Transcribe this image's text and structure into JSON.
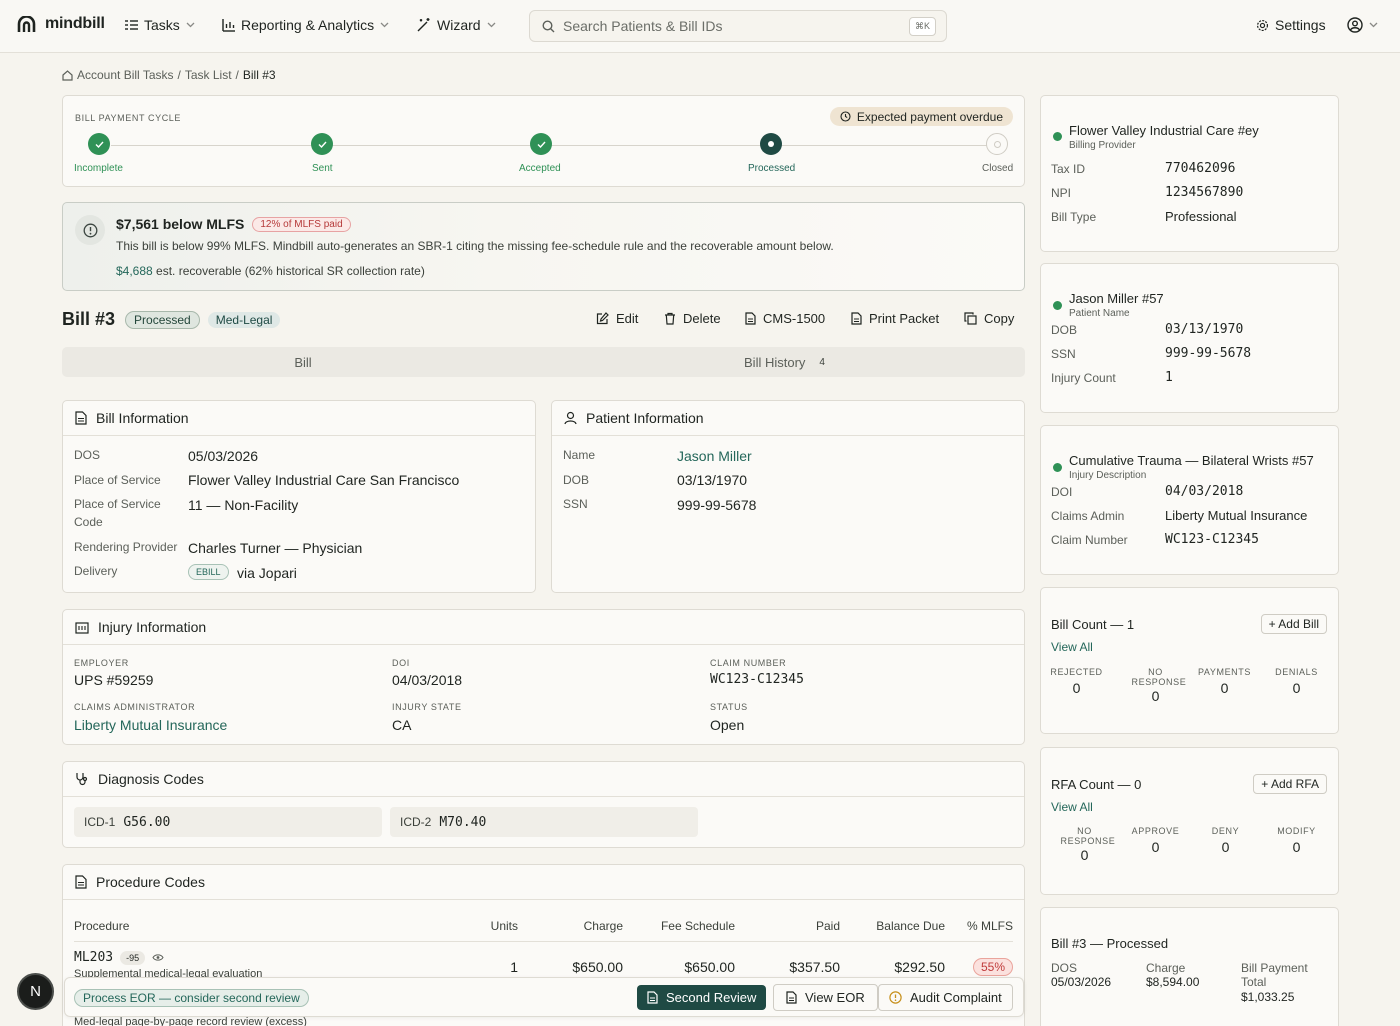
{
  "app": {
    "name": "mindbill"
  },
  "nav": {
    "tasks": "Tasks",
    "reporting": "Reporting & Analytics",
    "wizard": "Wizard",
    "search_placeholder": "Search Patients & Bill IDs",
    "shortcut": "⌘K",
    "settings": "Settings"
  },
  "breadcrumb": {
    "items": [
      "Account Bill Tasks",
      "Task List",
      "Bill #3"
    ],
    "sep": "/"
  },
  "cycle": {
    "label": "BILL PAYMENT CYCLE",
    "overdue": "Expected payment overdue",
    "steps": [
      {
        "label": "Incomplete",
        "state": "done"
      },
      {
        "label": "Sent",
        "state": "done"
      },
      {
        "label": "Accepted",
        "state": "done"
      },
      {
        "label": "Processed",
        "state": "current"
      },
      {
        "label": "Closed",
        "state": "pending"
      }
    ]
  },
  "mlfs": {
    "title": "$7,561 below MLFS",
    "badge": "12% of MLFS paid",
    "desc": "This bill is below 99% MLFS. Mindbill auto-generates an SBR-1 citing the missing fee-schedule rule and the recoverable amount below.",
    "amount": "$4,688",
    "note": "est. recoverable (62% historical SR collection rate)"
  },
  "bill": {
    "title": "Bill #3",
    "status": "Processed",
    "type": "Med-Legal",
    "actions": {
      "edit": "Edit",
      "delete": "Delete",
      "cms": "CMS-1500",
      "print": "Print Packet",
      "copy": "Copy"
    }
  },
  "tabs": {
    "bill": "Bill",
    "history": "Bill History",
    "history_count": "4"
  },
  "bill_info": {
    "title": "Bill Information",
    "dos_l": "DOS",
    "dos": "05/03/2026",
    "pos_l": "Place of Service",
    "pos": "Flower Valley Industrial Care San Francisco",
    "posc_l1": "Place of Service",
    "posc_l2": "Code",
    "posc": "11 — Non-Facility",
    "rp_l": "Rendering Provider",
    "rp": "Charles Turner — Physician",
    "del_l": "Delivery",
    "del_badge": "EBILL",
    "del": "via Jopari"
  },
  "patient_info": {
    "title": "Patient Information",
    "name_l": "Name",
    "name": "Jason Miller",
    "dob_l": "DOB",
    "dob": "03/13/1970",
    "ssn_l": "SSN",
    "ssn": "999-99-5678"
  },
  "injury": {
    "title": "Injury Information",
    "employer_l": "EMPLOYER",
    "employer": "UPS #59259",
    "doi_l": "DOI",
    "doi": "04/03/2018",
    "claim_l": "CLAIM NUMBER",
    "claim": "WC123-C12345",
    "admin_l": "CLAIMS ADMINISTRATOR",
    "admin": "Liberty Mutual Insurance",
    "state_l": "INJURY STATE",
    "state": "CA",
    "status_l": "STATUS",
    "status": "Open"
  },
  "diagnosis": {
    "title": "Diagnosis Codes",
    "codes": [
      {
        "k": "ICD-1",
        "v": "G56.00"
      },
      {
        "k": "ICD-2",
        "v": "M70.40"
      }
    ]
  },
  "procedures": {
    "title": "Procedure Codes",
    "headers": [
      "Procedure",
      "Units",
      "Charge",
      "Fee Schedule",
      "Paid",
      "Balance Due",
      "% MLFS"
    ],
    "rows": [
      {
        "code": "ML203",
        "mod": "-95",
        "desc": "Supplemental medical-legal evaluation",
        "units": "1",
        "charge": "$650.00",
        "fee": "$650.00",
        "paid": "$357.50",
        "balance": "$292.50",
        "pct": "55%"
      },
      {
        "desc": "Med-legal page-by-page record review (excess)"
      }
    ]
  },
  "actionbar": {
    "hint": "Process EOR — consider second review",
    "second": "Second Review",
    "view": "View EOR",
    "audit": "Audit Complaint"
  },
  "side": {
    "provider": {
      "name": "Flower Valley Industrial Care #ey",
      "sub": "Billing Provider",
      "tax_l": "Tax ID",
      "tax": "770462096",
      "npi_l": "NPI",
      "npi": "1234567890",
      "type_l": "Bill Type",
      "type": "Professional"
    },
    "patient": {
      "name": "Jason Miller #57",
      "sub": "Patient Name",
      "dob_l": "DOB",
      "dob": "03/13/1970",
      "ssn_l": "SSN",
      "ssn": "999-99-5678",
      "inj_l": "Injury Count",
      "inj": "1"
    },
    "injury": {
      "name": "Cumulative Trauma — Bilateral Wrists #57",
      "sub": "Injury Description",
      "doi_l": "DOI",
      "doi": "04/03/2018",
      "adm_l": "Claims Admin",
      "adm": "Liberty Mutual Insurance",
      "cn_l": "Claim Number",
      "cn": "WC123-C12345"
    },
    "billcount": {
      "title": "Bill Count — 1",
      "add": "+ Add Bill",
      "view": "View All",
      "stats": [
        {
          "l": "REJECTED",
          "v": "0"
        },
        {
          "l": "NO RESPONSE",
          "v": "0"
        },
        {
          "l": "PAYMENTS",
          "v": "0"
        },
        {
          "l": "DENIALS",
          "v": "0"
        }
      ]
    },
    "rfacount": {
      "title": "RFA Count — 0",
      "add": "+ Add RFA",
      "view": "View All",
      "stats": [
        {
          "l": "NO RESPONSE",
          "v": "0"
        },
        {
          "l": "APPROVE",
          "v": "0"
        },
        {
          "l": "DENY",
          "v": "0"
        },
        {
          "l": "MODIFY",
          "v": "0"
        }
      ]
    },
    "billsum": {
      "title": "Bill #3 — Processed",
      "dos_l": "DOS",
      "dos": "05/03/2026",
      "charge_l": "Charge",
      "charge": "$8,594.00",
      "total_l1": "Bill Payment",
      "total_l2": "Total",
      "total": "$1,033.25"
    }
  },
  "fab": {
    "label": "N"
  }
}
